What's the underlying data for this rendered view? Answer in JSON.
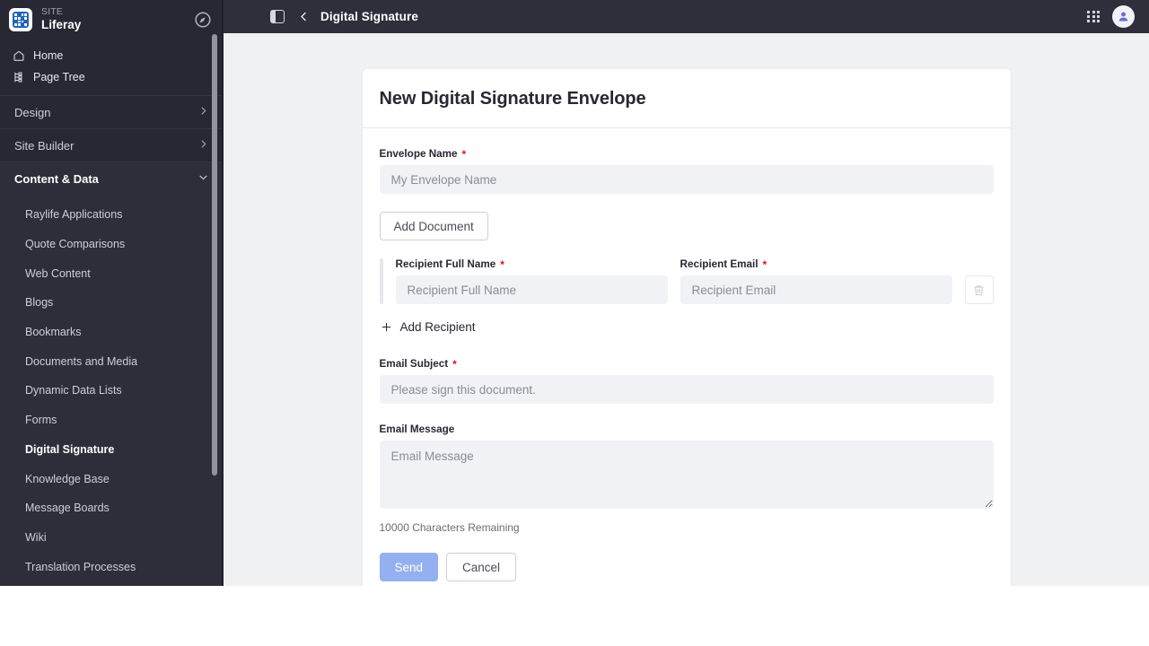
{
  "sidebar": {
    "brand": {
      "site_label": "SITE",
      "site_name": "Liferay",
      "logo_icon": "liferay-logo-icon",
      "compass_icon": "compass-icon"
    },
    "quick_links": [
      {
        "label": "Home",
        "icon": "home-icon"
      },
      {
        "label": "Page Tree",
        "icon": "page-tree-icon"
      }
    ],
    "sections": [
      {
        "label": "Design",
        "state": "collapsed",
        "icon": "chevron-right-icon"
      },
      {
        "label": "Site Builder",
        "state": "collapsed",
        "icon": "chevron-right-icon"
      },
      {
        "label": "Content & Data",
        "state": "expanded",
        "icon": "chevron-down-icon"
      }
    ],
    "items": [
      {
        "label": "Raylife Applications",
        "active": false
      },
      {
        "label": "Quote Comparisons",
        "active": false
      },
      {
        "label": "Web Content",
        "active": false
      },
      {
        "label": "Blogs",
        "active": false
      },
      {
        "label": "Bookmarks",
        "active": false
      },
      {
        "label": "Documents and Media",
        "active": false
      },
      {
        "label": "Dynamic Data Lists",
        "active": false
      },
      {
        "label": "Forms",
        "active": false
      },
      {
        "label": "Digital Signature",
        "active": true
      },
      {
        "label": "Knowledge Base",
        "active": false
      },
      {
        "label": "Message Boards",
        "active": false
      },
      {
        "label": "Wiki",
        "active": false
      },
      {
        "label": "Translation Processes",
        "active": false
      }
    ]
  },
  "topbar": {
    "panel_toggle_icon": "sidebar-toggle-icon",
    "back_icon": "chevron-left-icon",
    "breadcrumb": "Digital Signature",
    "apps_icon": "grid-apps-icon",
    "avatar_icon": "user-avatar-icon"
  },
  "form": {
    "title": "New Digital Signature Envelope",
    "envelope_name": {
      "label": "Envelope Name",
      "required_mark": "*",
      "placeholder": "My Envelope Name",
      "value": ""
    },
    "add_document_label": "Add Document",
    "recipient": {
      "full_name": {
        "label": "Recipient Full Name",
        "required_mark": "*",
        "placeholder": "Recipient Full Name",
        "value": ""
      },
      "email": {
        "label": "Recipient Email",
        "required_mark": "*",
        "placeholder": "Recipient Email",
        "value": ""
      },
      "delete_icon": "trash-icon"
    },
    "add_recipient": {
      "label": "Add Recipient",
      "icon": "plus-icon"
    },
    "email_subject": {
      "label": "Email Subject",
      "required_mark": "*",
      "placeholder": "Please sign this document.",
      "value": ""
    },
    "email_message": {
      "label": "Email Message",
      "placeholder": "Email Message",
      "value": ""
    },
    "characters_remaining": "10000 Characters Remaining",
    "send_label": "Send",
    "cancel_label": "Cancel"
  },
  "colors": {
    "sidebar_bg": "#272833",
    "sidebar_sub_bg": "#2d2e3a",
    "topbar_bg": "#2e2f3b",
    "content_bg": "#f0f1f3",
    "card_bg": "#ffffff",
    "input_bg": "#f1f2f5",
    "required_red": "#da1414",
    "send_disabled_blue": "#95b0ef",
    "text_primary": "#272833"
  }
}
